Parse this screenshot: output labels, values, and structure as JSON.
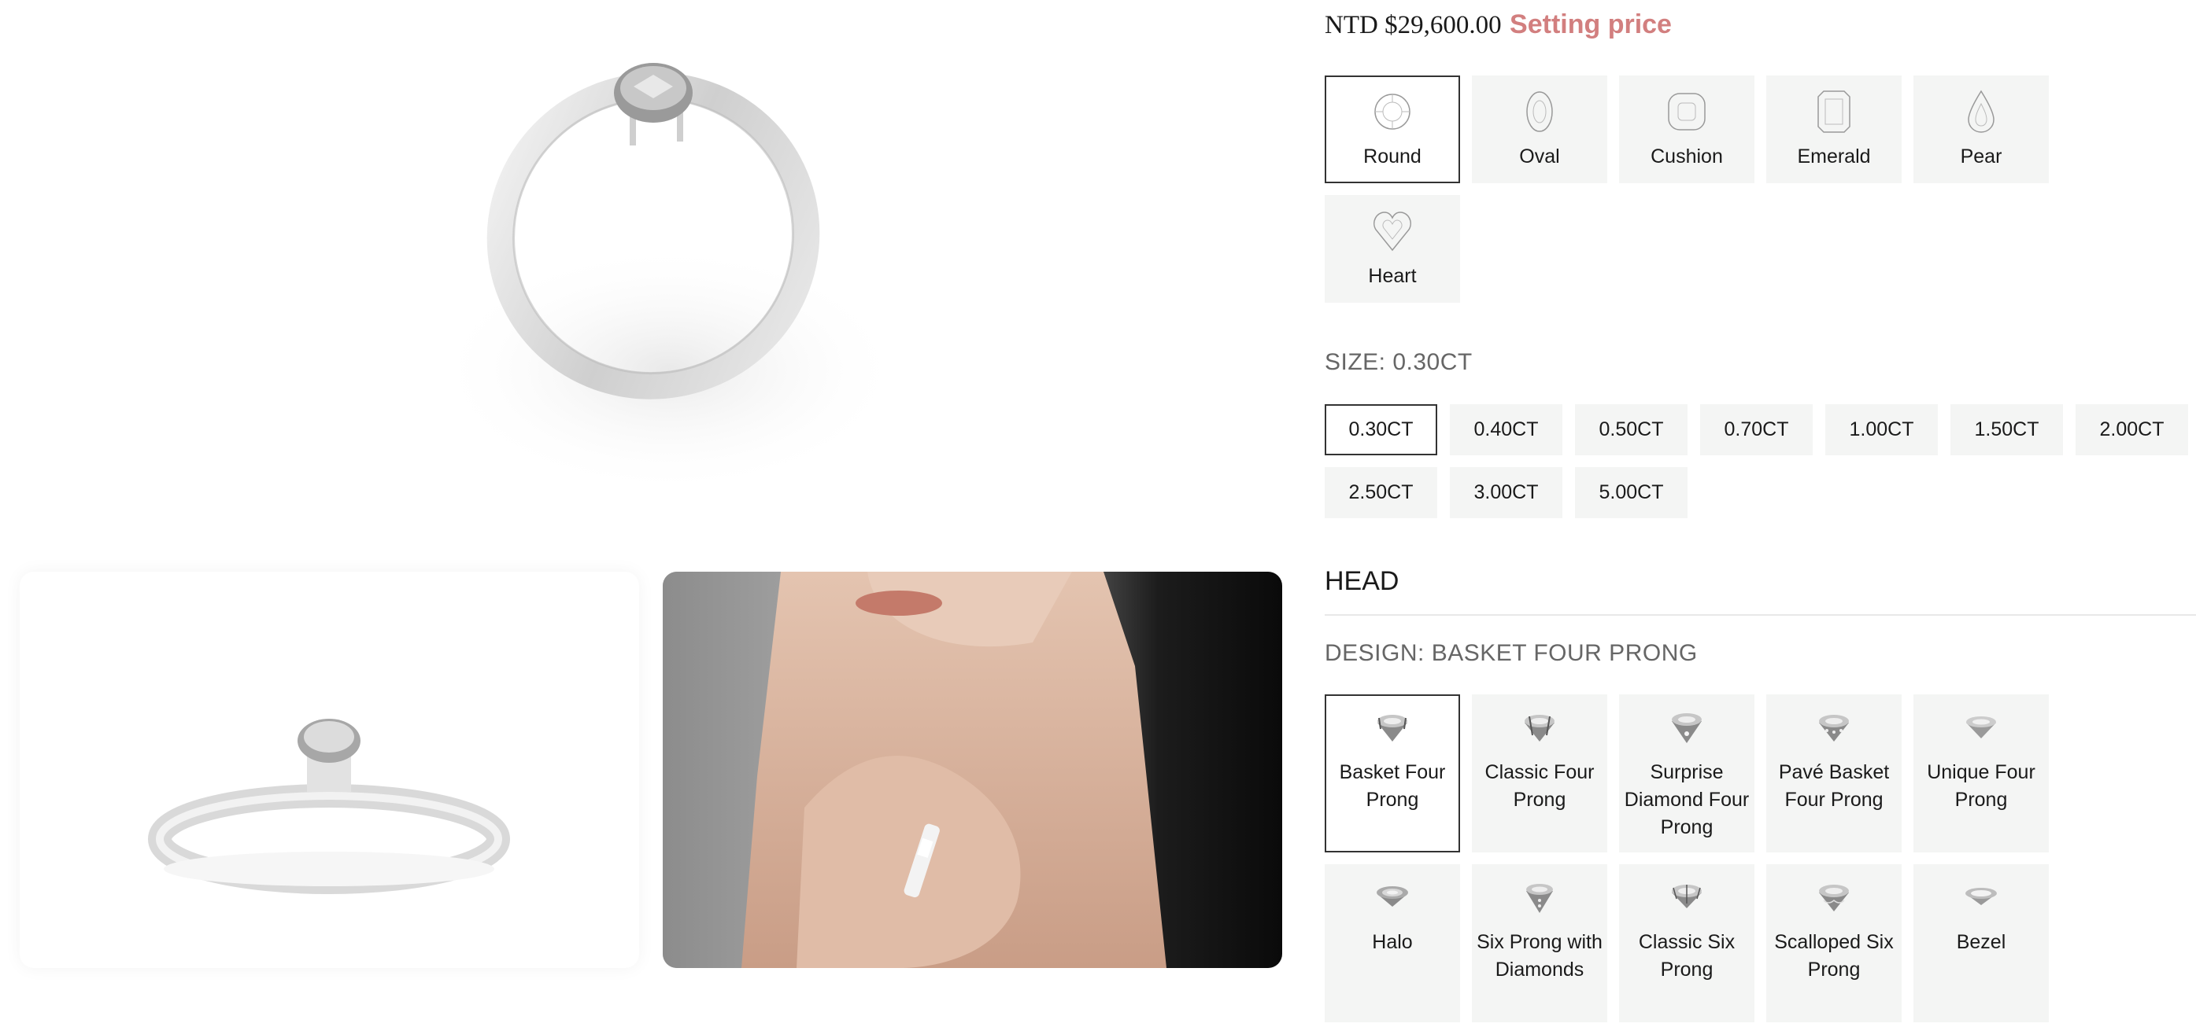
{
  "pricing": {
    "price": "NTD $29,600.00",
    "setting_label": "Setting price"
  },
  "shapes": [
    {
      "label": "Round",
      "icon": "round-diamond-icon",
      "selected": true
    },
    {
      "label": "Oval",
      "icon": "oval-diamond-icon",
      "selected": false
    },
    {
      "label": "Cushion",
      "icon": "cushion-diamond-icon",
      "selected": false
    },
    {
      "label": "Emerald",
      "icon": "emerald-diamond-icon",
      "selected": false
    },
    {
      "label": "Pear",
      "icon": "pear-diamond-icon",
      "selected": false
    },
    {
      "label": "Heart",
      "icon": "heart-diamond-icon",
      "selected": false
    }
  ],
  "size": {
    "label": "SIZE: 0.30CT",
    "options": [
      "0.30CT",
      "0.40CT",
      "0.50CT",
      "0.70CT",
      "1.00CT",
      "1.50CT",
      "2.00CT",
      "2.50CT",
      "3.00CT",
      "5.00CT"
    ],
    "selected": "0.30CT"
  },
  "head": {
    "title": "HEAD",
    "design_label": "DESIGN: BASKET FOUR PRONG"
  },
  "designs": [
    {
      "label": "Basket Four Prong",
      "icon": "basket-four-prong-icon",
      "selected": true
    },
    {
      "label": "Classic Four Prong",
      "icon": "classic-four-prong-icon",
      "selected": false
    },
    {
      "label": "Surprise Diamond Four Prong",
      "icon": "surprise-diamond-icon",
      "selected": false
    },
    {
      "label": "Pavé Basket Four Prong",
      "icon": "pave-basket-icon",
      "selected": false
    },
    {
      "label": "Unique Four Prong",
      "icon": "unique-four-prong-icon",
      "selected": false
    },
    {
      "label": "Halo",
      "icon": "halo-icon",
      "selected": false
    },
    {
      "label": "Six Prong with Diamonds",
      "icon": "six-prong-diamonds-icon",
      "selected": false
    },
    {
      "label": "Classic Six Prong",
      "icon": "classic-six-prong-icon",
      "selected": false
    },
    {
      "label": "Scalloped Six Prong",
      "icon": "scalloped-six-prong-icon",
      "selected": false
    },
    {
      "label": "Bezel",
      "icon": "bezel-icon",
      "selected": false
    }
  ],
  "colors": {
    "accent": "#d27f7f",
    "option_bg": "#f4f5f4",
    "selected_border": "#333333",
    "label_gray": "#666666"
  }
}
